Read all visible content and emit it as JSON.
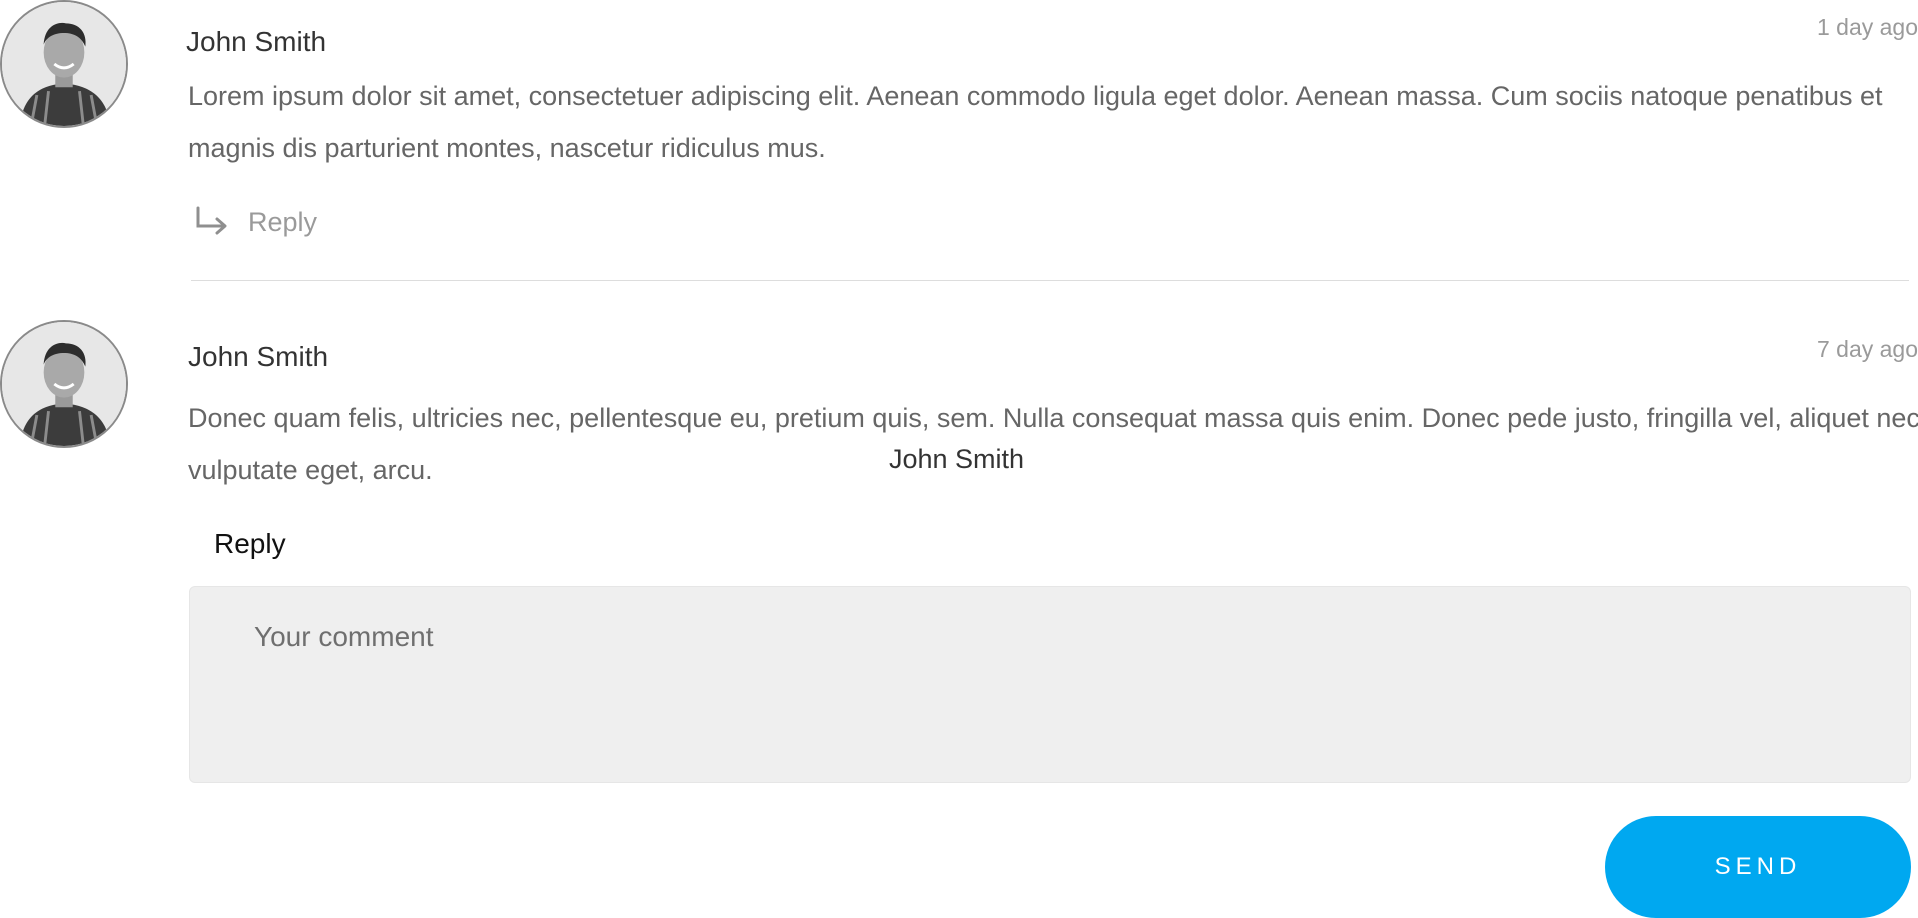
{
  "comments": [
    {
      "author": "John Smith",
      "time": "1 day ago",
      "text": "Lorem ipsum dolor sit amet, consectetuer adipiscing elit. Aenean commodo ligula eget dolor. Aenean massa. Cum sociis natoque penatibus et magnis dis parturient montes, nascetur ridiculus mus.",
      "reply_label": "Reply",
      "icons": [
        "avatar-photo",
        "reply-arrow-icon"
      ]
    },
    {
      "author": "John Smith",
      "time": "7 day ago",
      "text": "Donec quam felis, ultricies nec, pellentesque eu, pretium quis, sem. Nulla consequat massa quis enim. Donec pede justo, fringilla vel, aliquet nec, vulputate eget, arcu."
    }
  ],
  "floating_author": "John Smith",
  "reply_form": {
    "heading": "Reply",
    "placeholder": "Your comment",
    "value": "",
    "send_label": "SEND"
  },
  "colors": {
    "accent": "#00a8f0",
    "text": "#666666",
    "muted": "#9a9a9a",
    "input_bg": "#efefef"
  }
}
